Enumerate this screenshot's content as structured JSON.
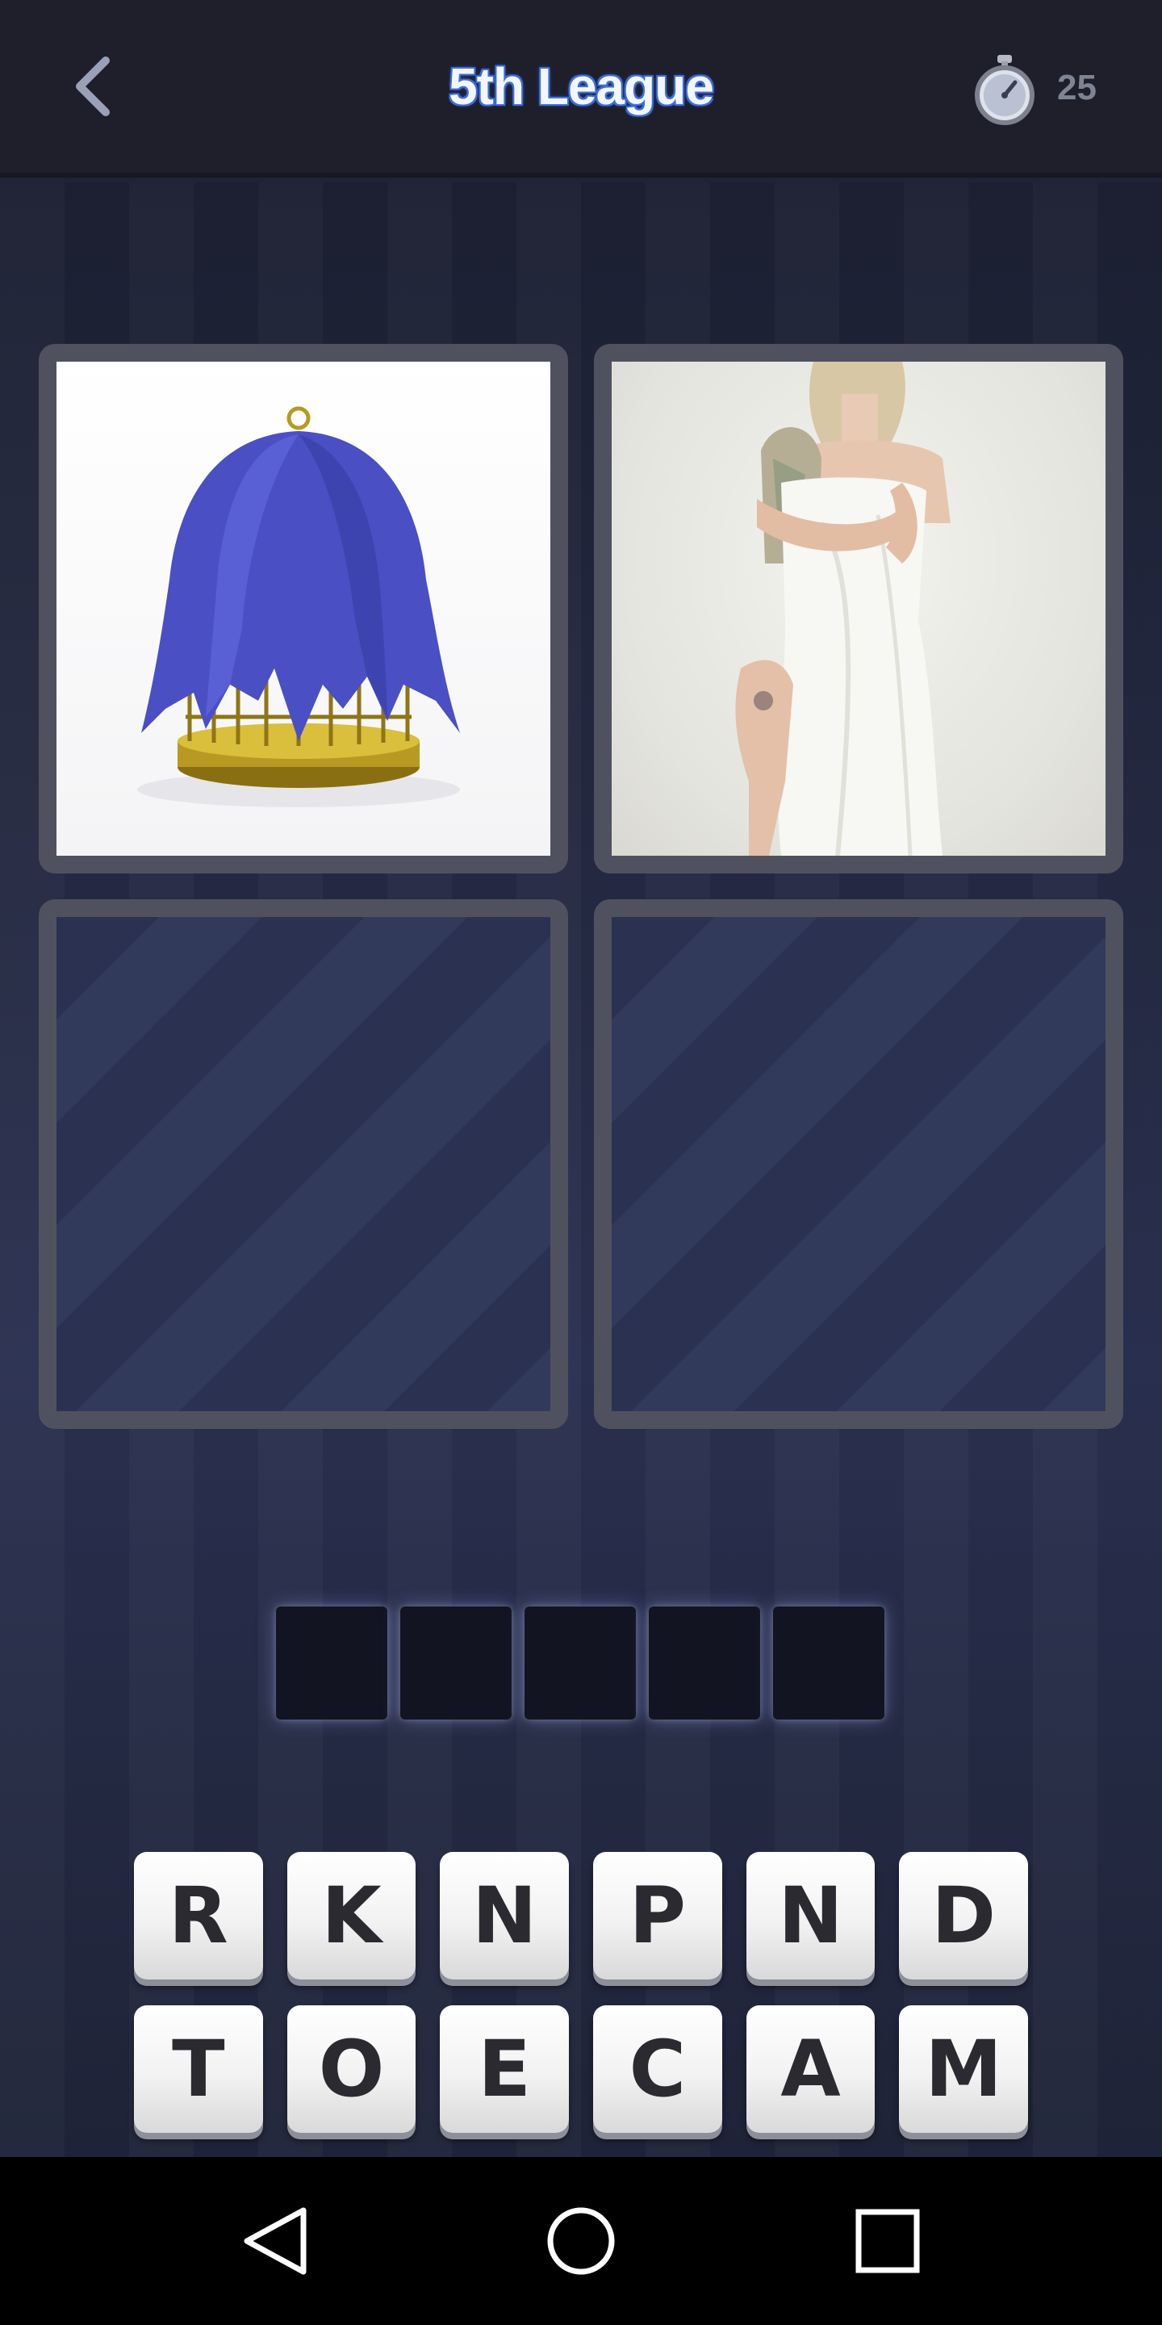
{
  "header": {
    "title": "5th League",
    "timer_count": "25"
  },
  "icons": {
    "back": "chevron-left-icon",
    "timer": "stopwatch-icon"
  },
  "tiles": [
    {
      "state": "revealed",
      "content": "birdcage-covered-with-cloth"
    },
    {
      "state": "revealed",
      "content": "woman-wrapped-in-sheet"
    },
    {
      "state": "locked"
    },
    {
      "state": "locked"
    }
  ],
  "answer": {
    "slot_count": 5,
    "letters": [
      "",
      "",
      "",
      "",
      ""
    ]
  },
  "letters": {
    "row1": [
      "R",
      "K",
      "N",
      "P",
      "N",
      "D"
    ],
    "row2": [
      "T",
      "O",
      "E",
      "C",
      "A",
      "M"
    ]
  },
  "navbar": {
    "buttons": [
      "back-triangle",
      "home-circle",
      "recents-square"
    ]
  },
  "colors": {
    "title_glow": "#3f6fd8",
    "background": "#262b45",
    "tile_border": "#4f525e",
    "slot": "#121422"
  }
}
